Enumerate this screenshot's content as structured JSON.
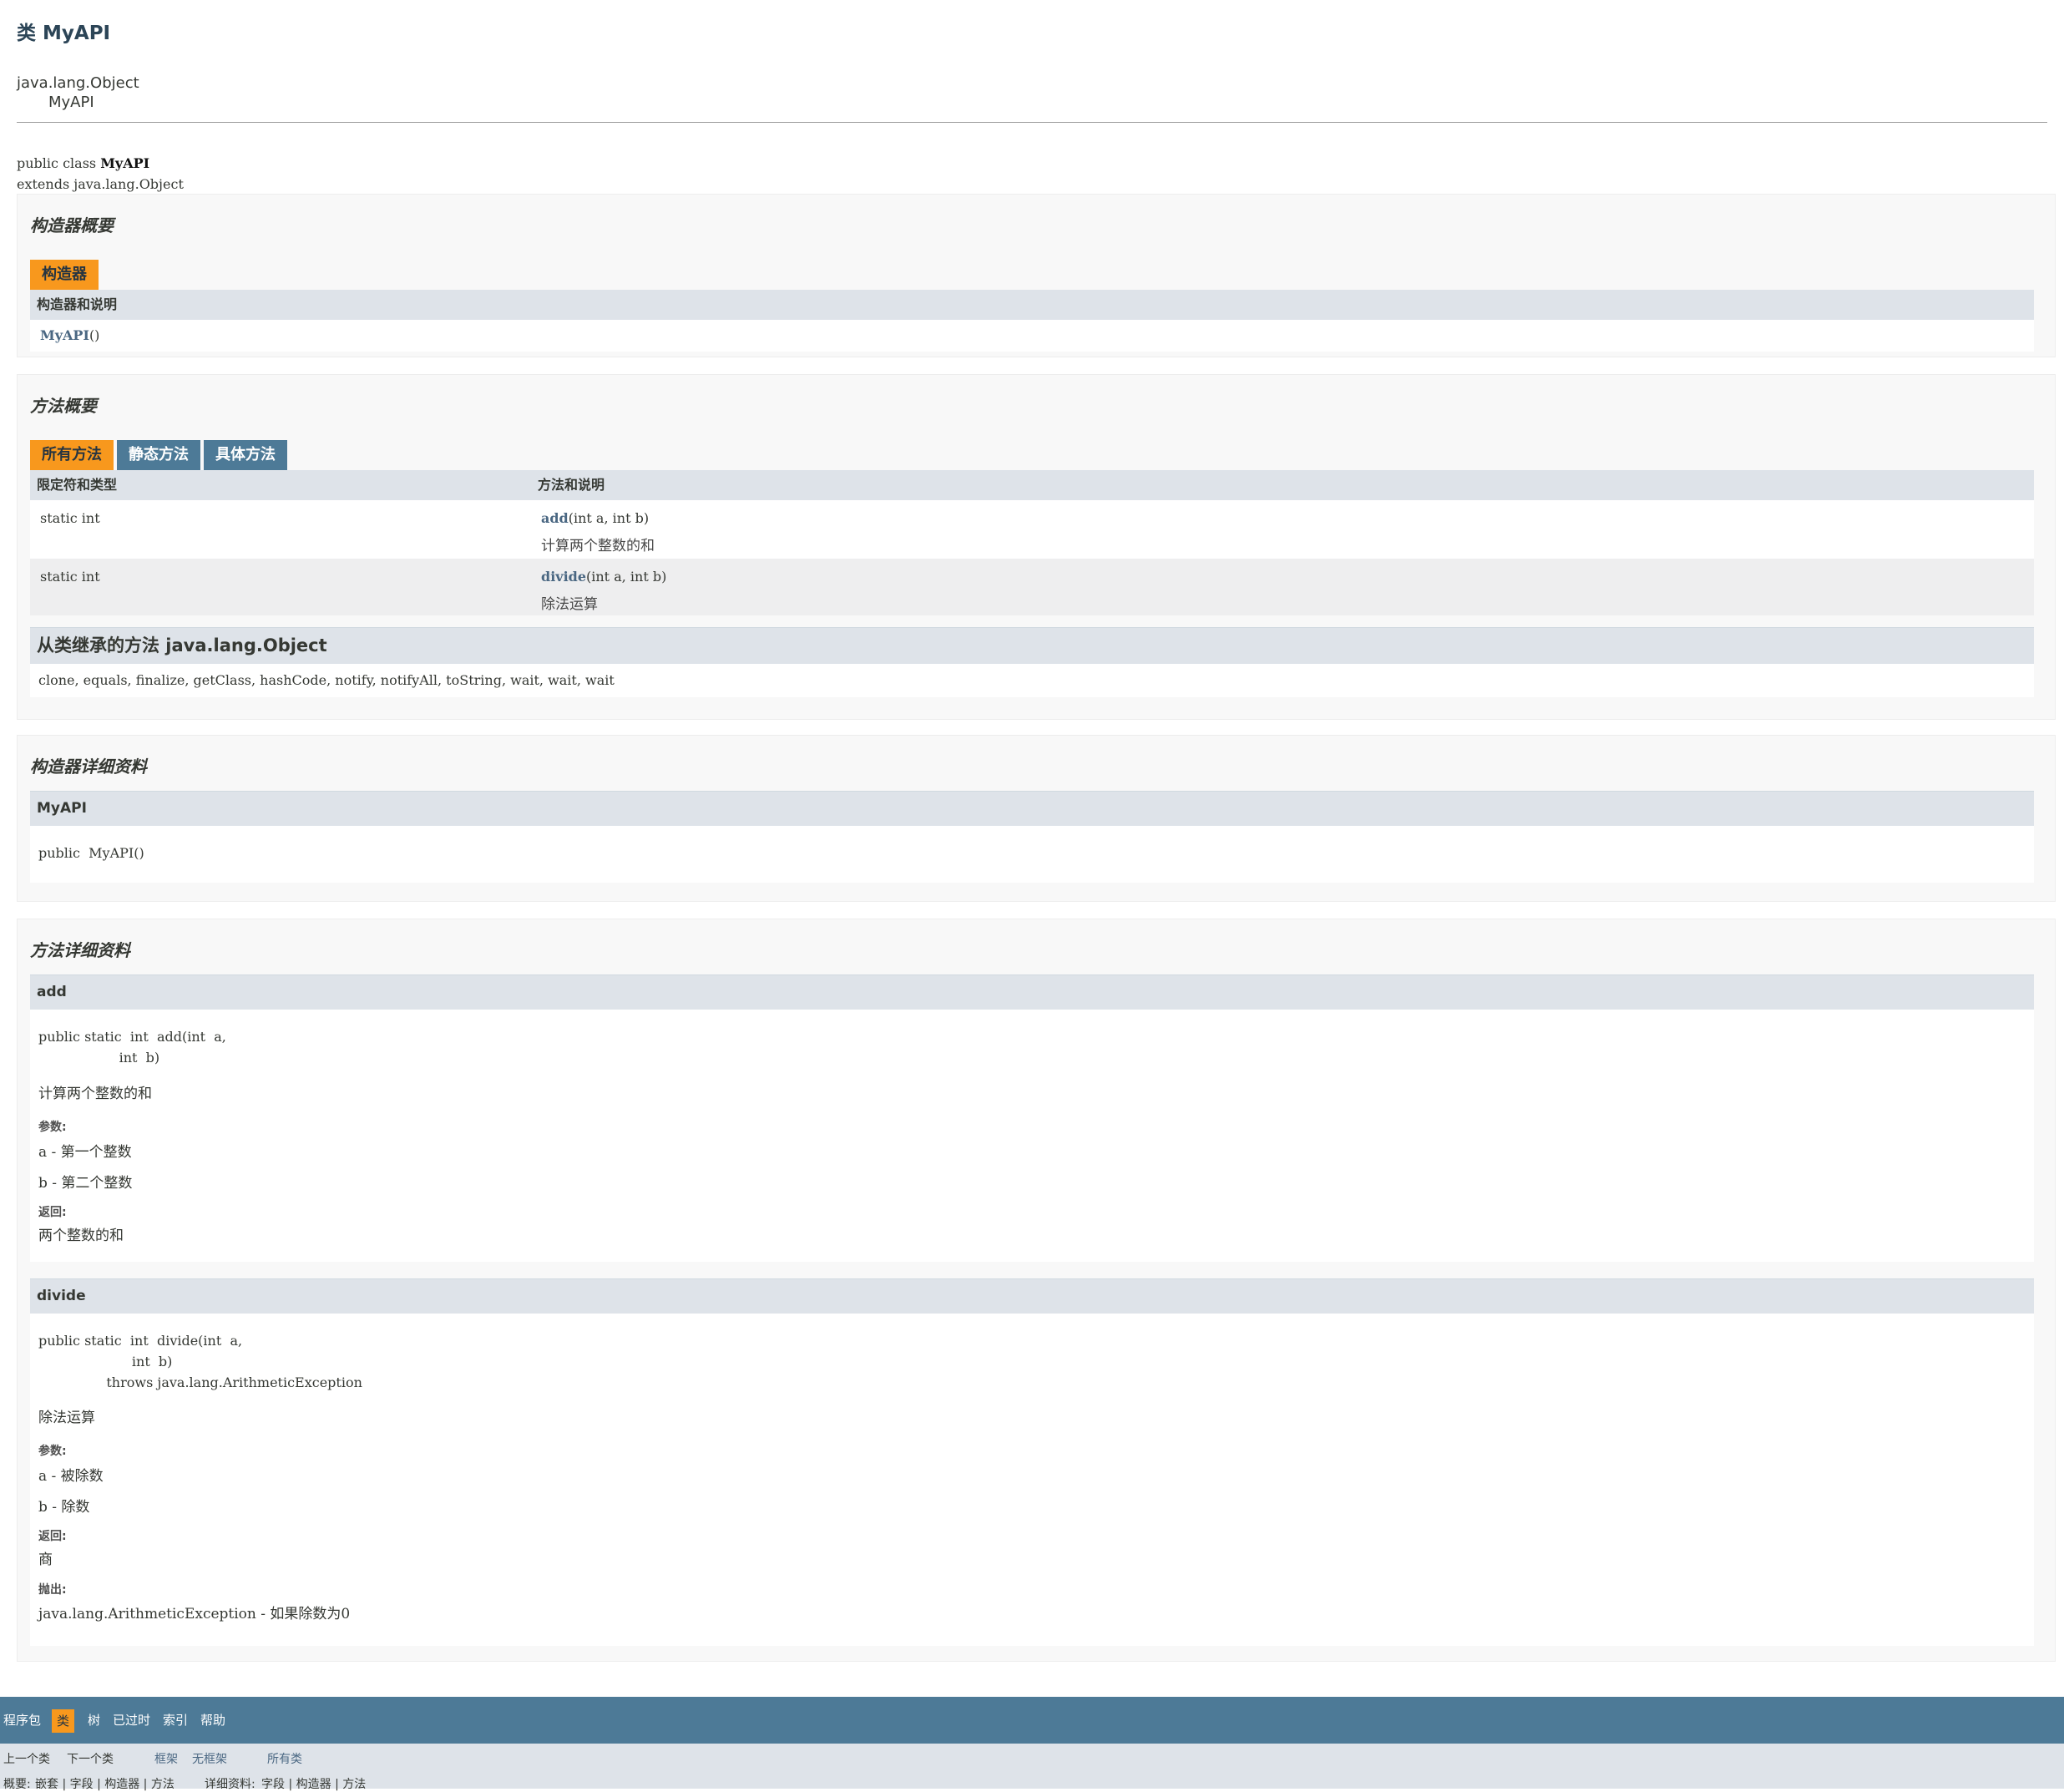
{
  "header": {
    "title": "类 MyAPI",
    "hierarchy_root": "java.lang.Object",
    "hierarchy_child": "MyAPI",
    "decl_prefix": "public class ",
    "decl_class": "MyAPI",
    "decl_extends": "extends java.lang.Object"
  },
  "constructor_summary": {
    "title": "构造器概要",
    "tab": "构造器",
    "column_header": "构造器和说明",
    "rows": [
      {
        "name": "MyAPI",
        "params": "()"
      }
    ]
  },
  "method_summary": {
    "title": "方法概要",
    "tabs": [
      "所有方法",
      "静态方法",
      "具体方法"
    ],
    "col1": "限定符和类型",
    "col2": "方法和说明",
    "rows": [
      {
        "modifier": "static int",
        "name": "add",
        "params": "(int  a, int  b)",
        "desc": "计算两个整数的和"
      },
      {
        "modifier": "static int",
        "name": "divide",
        "params": "(int  a, int  b)",
        "desc": "除法运算"
      }
    ],
    "inherited_title": "从类继承的方法 java.lang.Object",
    "inherited_methods": "clone, equals, finalize, getClass, hashCode, notify, notifyAll, toString, wait, wait, wait"
  },
  "constructor_detail": {
    "title": "构造器详细资料",
    "name": "MyAPI",
    "signature": "public  MyAPI()"
  },
  "method_detail": {
    "title": "方法详细资料",
    "params_label": "参数:",
    "returns_label": "返回:",
    "throws_label": "抛出:",
    "add": {
      "name": "add",
      "signature": "public static  int  add(int  a,\n                   int  b)",
      "desc": "计算两个整数的和",
      "param_a": "a - 第一个整数",
      "param_b": "b - 第二个整数",
      "returns": "两个整数的和"
    },
    "divide": {
      "name": "divide",
      "signature": "public static  int  divide(int  a,\n                      int  b)\n                throws java.lang.ArithmeticException",
      "desc": "除法运算",
      "param_a": "a - 被除数",
      "param_b": "b - 除数",
      "returns": "商",
      "throws": "java.lang.ArithmeticException - 如果除数为0"
    }
  },
  "nav": {
    "package": "程序包",
    "class": "类",
    "tree": "树",
    "deprecated": "已过时",
    "index": "索引",
    "help": "帮助",
    "prev_class": "上一个类",
    "next_class": "下一个类",
    "frames": "框架",
    "no_frames": "无框架",
    "all_classes": "所有类",
    "summary_label": "概要:",
    "summary_items": "嵌套 | 字段 | 构造器 | 方法",
    "detail_label": "详细资料:",
    "detail_items": "字段 | 构造器 | 方法"
  },
  "colors": {
    "nav_bar": "#4d7a97",
    "active_tab": "#f8981d",
    "table_header": "#dee3e9",
    "link": "#4a6782"
  }
}
